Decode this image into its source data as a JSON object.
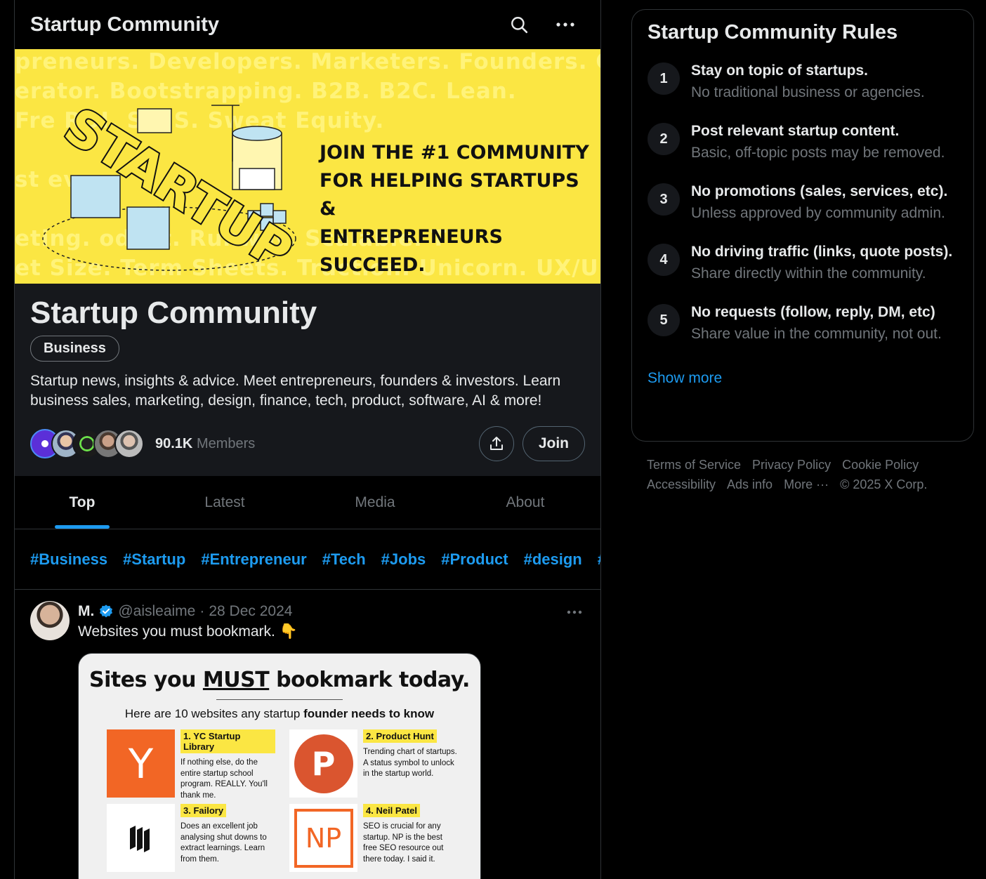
{
  "header": {
    "title": "Startup Community"
  },
  "banner": {
    "bg_lines": [
      "preneurs. Developers. Marketers. Founders. CEOs",
      "erator. Bootstrapping. B2B. B2C. Lean.",
      "Fre ROI. SaaS. Sweat Equity.",
      "st ev",
      "eting. oduct. Runway. Scalable. T",
      "et Size. Term Sheets. Traction. Unicorn. UX/UI. Valu"
    ],
    "art_word": "STARTUP",
    "tagline": [
      "JOIN THE #1 COMMUNITY",
      "FOR HELPING STARTUPS &",
      "ENTREPRENEURS SUCCEED."
    ],
    "bg_color": "#fbe643"
  },
  "community": {
    "name": "Startup Community",
    "topic": "Business",
    "description": "Startup news, insights & advice. Meet entrepreneurs, founders & investors. Learn business sales, marketing, design, finance, tech, product, software, AI & more!",
    "member_count": "90.1K",
    "members_label": "Members",
    "join_label": "Join"
  },
  "tabs": [
    {
      "label": "Top",
      "active": true
    },
    {
      "label": "Latest"
    },
    {
      "label": "Media"
    },
    {
      "label": "About"
    }
  ],
  "hashtags": [
    "#Business",
    "#Startup",
    "#Entrepreneur",
    "#Tech",
    "#Jobs",
    "#Product",
    "#design",
    "#"
  ],
  "post": {
    "author": "M.",
    "handle": "@aisleaime",
    "separator": "·",
    "date": "28 Dec 2024",
    "text": "Websites you must bookmark. 👇",
    "image": {
      "title_pre": "Sites you ",
      "title_em": "MUST",
      "title_post": " bookmark today.",
      "subtitle_pre": "Here are 10 websites any startup ",
      "subtitle_bold": "founder needs to know",
      "cards": [
        {
          "title": "1. YC Startup Library",
          "text": "If nothing else, do the entire startup school program. REALLY. You'll thank me.",
          "logo": "Y"
        },
        {
          "title": "2. Product Hunt",
          "text": "Trending chart of startups. A status symbol to unlock in the startup world.",
          "logo": "P"
        },
        {
          "title": "3. Failory",
          "text": "Does an excellent job analysing shut downs to extract learnings. Learn from them.",
          "logo": "failory-icon"
        },
        {
          "title": "4. Neil Patel",
          "text": "SEO is crucial for any startup. NP is the best free SEO resource out there today. I said it.",
          "logo": "NP"
        }
      ]
    }
  },
  "rules": {
    "title": "Startup Community Rules",
    "items": [
      {
        "num": "1",
        "title": "Stay on topic of startups.",
        "desc": "No traditional business or agencies."
      },
      {
        "num": "2",
        "title": "Post relevant startup content.",
        "desc": "Basic, off-topic posts may be removed."
      },
      {
        "num": "3",
        "title": "No promotions (sales, services, etc).",
        "desc": "Unless approved by community admin."
      },
      {
        "num": "4",
        "title": "No driving traffic (links, quote posts).",
        "desc": "Share directly within the community."
      },
      {
        "num": "5",
        "title": "No requests (follow, reply, DM, etc)",
        "desc": "Share value in the community, not out."
      }
    ],
    "show_more": "Show more"
  },
  "footer": {
    "links": [
      "Terms of Service",
      "Privacy Policy",
      "Cookie Policy",
      "Accessibility",
      "Ads info",
      "More ···"
    ],
    "copyright": "© 2025 X Corp."
  },
  "colors": {
    "accent": "#1d9bf0",
    "background": "#000000",
    "muted": "#71767b"
  }
}
